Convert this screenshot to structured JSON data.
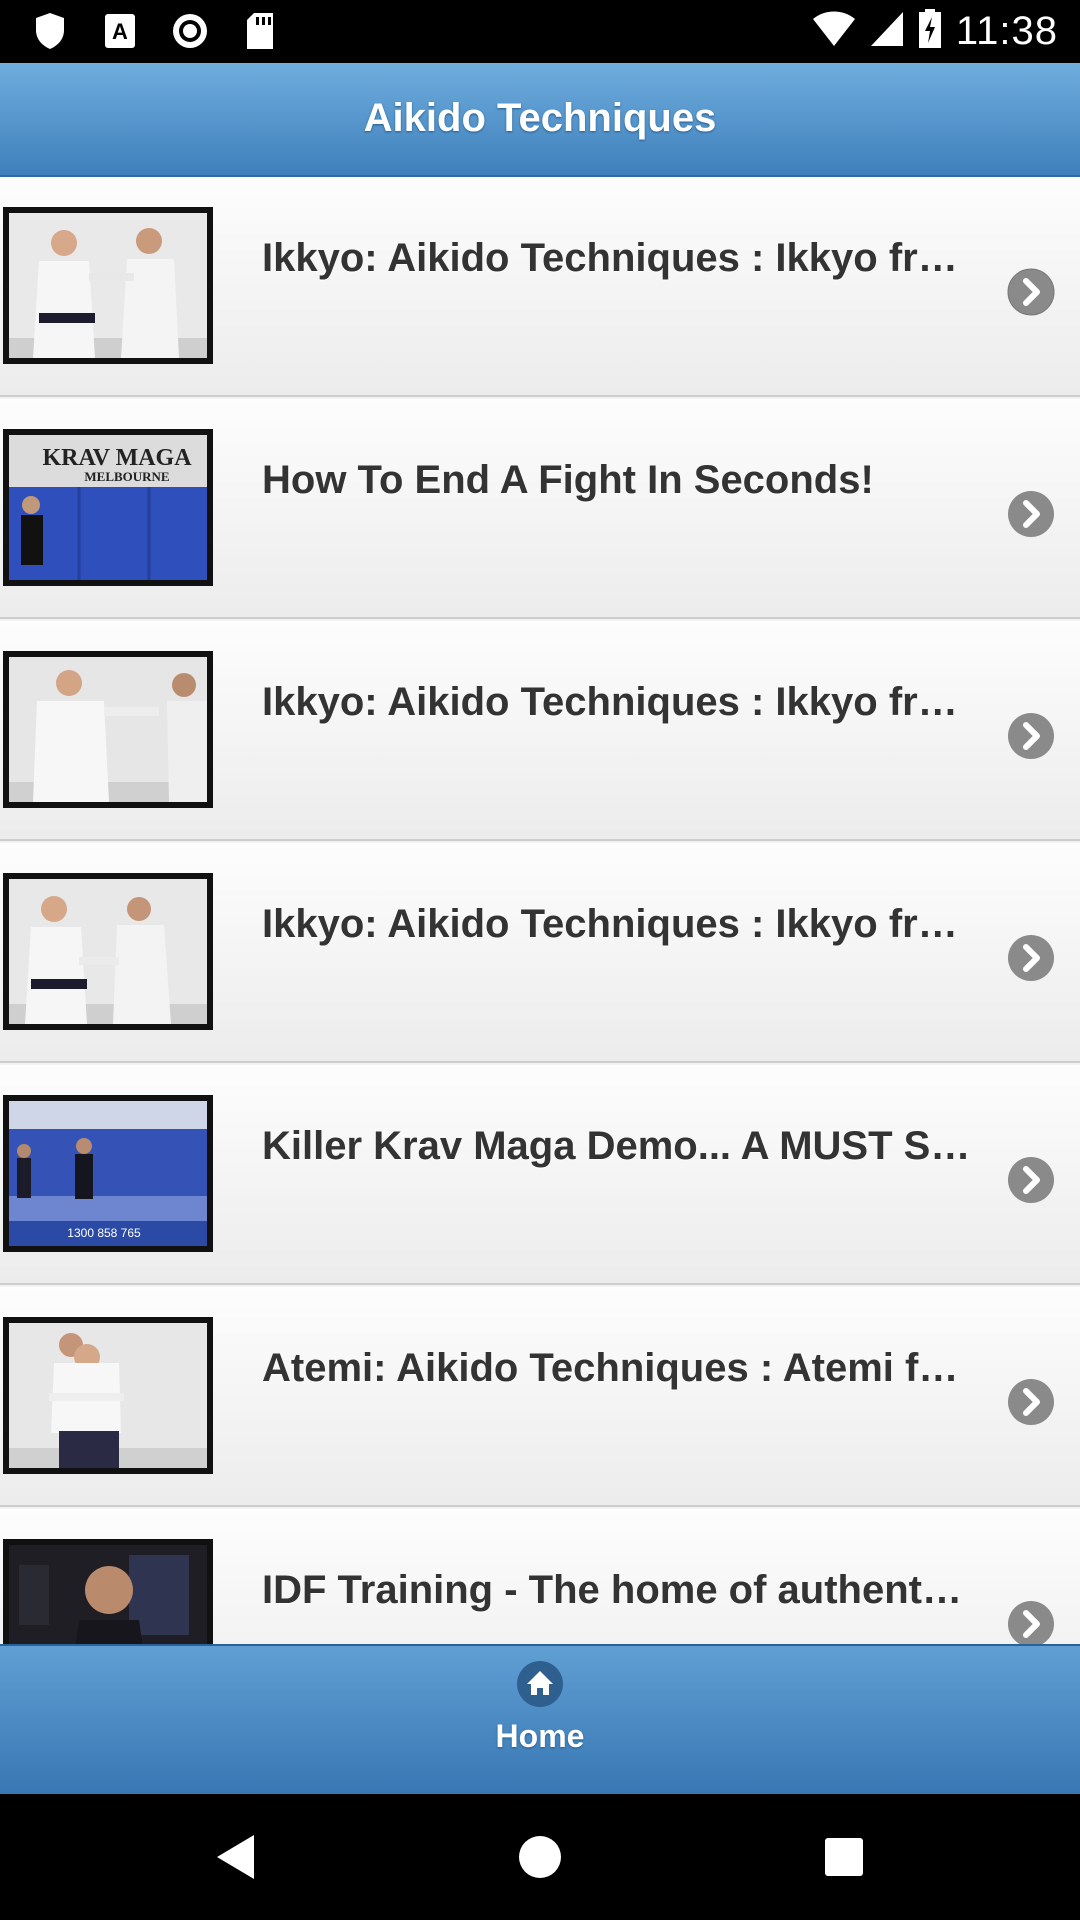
{
  "status_bar": {
    "time": "11:38",
    "icons": [
      "shield-icon",
      "font-a-icon",
      "record-icon",
      "sd-card-icon",
      "wifi-icon",
      "cell-signal-icon",
      "battery-charging-icon"
    ]
  },
  "header": {
    "title": "Aikido Techniques"
  },
  "videos": [
    {
      "title": "Ikkyo: Aikido Techniques : Ikkyo from Front Strike",
      "thumb": "aikido-white"
    },
    {
      "title": "How To End A Fight In Seconds!",
      "thumb": "krav-maga-melbourne"
    },
    {
      "title": "Ikkyo: Aikido Techniques : Ikkyo from Front Strike",
      "thumb": "aikido-white"
    },
    {
      "title": "Ikkyo: Aikido Techniques : Ikkyo from Wrist Grab",
      "thumb": "aikido-white"
    },
    {
      "title": "Killer Krav Maga Demo... A MUST SEE",
      "thumb": "krav-maga-blue-mat"
    },
    {
      "title": "Atemi: Aikido Techniques : Atemi from Rear Choke",
      "thumb": "aikido-white"
    },
    {
      "title": "IDF Training - The home of authentic Krav Maga",
      "thumb": "idf-training"
    }
  ],
  "footer": {
    "home_label": "Home"
  },
  "colors": {
    "header_top": "#6faddd",
    "header_bottom": "#3f80bc",
    "text": "#333333"
  }
}
